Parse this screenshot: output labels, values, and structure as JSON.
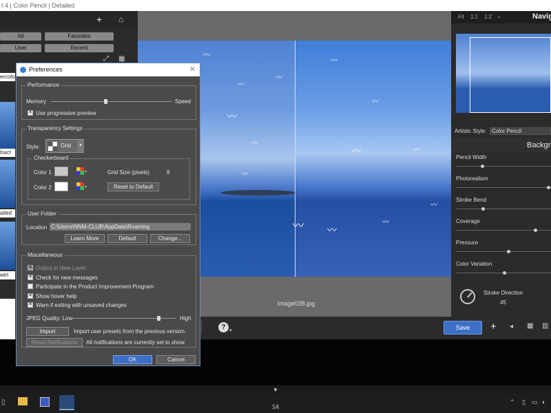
{
  "window": {
    "title": "t 4 | Color Pencil | Detailed"
  },
  "left_panel": {
    "buttons": {
      "all": "All",
      "favorites": "Favorites",
      "user": "User",
      "recent": "Recent"
    },
    "thumb_labels": [
      "ercolo",
      "tract",
      "ailed",
      "wirl"
    ]
  },
  "canvas": {
    "filename": "Image038.jpg"
  },
  "toolbar": {
    "save_label": "Save",
    "help_label": "?"
  },
  "taskbar": {
    "right_text": "SA"
  },
  "navigator": {
    "zoom_fit": "Fit",
    "zoom_1_1": "1:1",
    "zoom_1_2": "1:2",
    "title": "Navig"
  },
  "artistic": {
    "style_label": "Artistic Style:",
    "style_value": "Color Pencil",
    "section_title": "Backgro",
    "sliders": [
      {
        "label": "Pencil Width",
        "value": 0.27
      },
      {
        "label": "Photorealism",
        "value": 0.97
      },
      {
        "label": "Stroke Bend",
        "value": 0.28
      },
      {
        "label": "Coverage",
        "value": 0.83
      },
      {
        "label": "Pressure",
        "value": 0.55
      },
      {
        "label": "Color Variation",
        "value": 0.5
      }
    ],
    "stroke_direction": {
      "label": "Stroke Direction",
      "value": "45"
    }
  },
  "dialog": {
    "title": "Preferences",
    "performance": {
      "title": "Performance",
      "memory_label": "Memory",
      "speed_label": "Speed",
      "slider_value": 0.45,
      "progressive_preview_label": "Use progressive preview",
      "progressive_preview_checked": true
    },
    "transparency": {
      "title": "Transparency Settings",
      "style_label": "Style:",
      "style_value": "Grid",
      "checkerboard_title": "Checkerboard",
      "color1_label": "Color 1",
      "color1": "#c8c8c8",
      "color2_label": "Color 2",
      "color2": "#ffffff",
      "grid_size_label": "Grid Size (pixels)",
      "grid_size_value": "8",
      "reset_label": "Reset to Default"
    },
    "user_folder": {
      "title": "User Folder",
      "location_label": "Location",
      "location_value": "C:\\Users\\NNM-CLUB\\AppData\\Roaming",
      "learn_more_label": "Learn More",
      "default_label": "Default",
      "change_label": "Change..."
    },
    "misc": {
      "title": "Miscellaneous",
      "checkboxes": [
        {
          "label": "Output in New Layer",
          "checked": true,
          "disabled": true
        },
        {
          "label": "Check for new messages",
          "checked": true,
          "disabled": false
        },
        {
          "label": "Participate in the Product Improvement Program",
          "checked": false,
          "disabled": false
        },
        {
          "label": "Show hover help",
          "checked": true,
          "disabled": false
        },
        {
          "label": "Warn if exiting with unsaved changes",
          "checked": true,
          "disabled": false
        }
      ],
      "jpeg_label": "JPEG Quality: Low",
      "jpeg_high": "High",
      "jpeg_value": 0.83,
      "import_label": "Import",
      "import_desc": "Import user presets from the previous version.",
      "reset_notif_label": "Reset Notifications",
      "notif_desc": "All notifications are currently set to show."
    },
    "ok_label": "OK",
    "cancel_label": "Cancel"
  }
}
